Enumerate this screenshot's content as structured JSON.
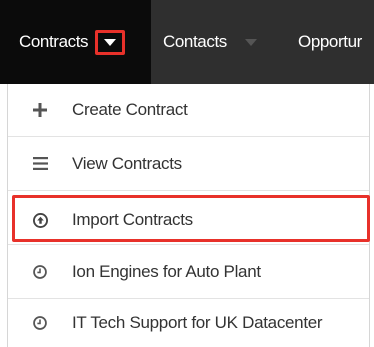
{
  "nav": {
    "tabs": [
      {
        "label": "Contracts"
      },
      {
        "label": "Contacts"
      },
      {
        "label": "Opportur"
      }
    ]
  },
  "dropdown": {
    "items": [
      {
        "label": "Create Contract",
        "icon": "plus-icon"
      },
      {
        "label": "View Contracts",
        "icon": "list-icon"
      },
      {
        "label": "Import Contracts",
        "icon": "upload-circle-icon"
      },
      {
        "label": "Ion Engines for Auto Plant",
        "icon": "clock-icon"
      },
      {
        "label": "IT Tech Support for UK Datacenter",
        "icon": "clock-icon"
      }
    ]
  },
  "colors": {
    "navbar_bg": "#2f2f2f",
    "active_tab_bg": "#0b0b0b",
    "highlight": "#e8312a",
    "menu_text": "#333333"
  }
}
